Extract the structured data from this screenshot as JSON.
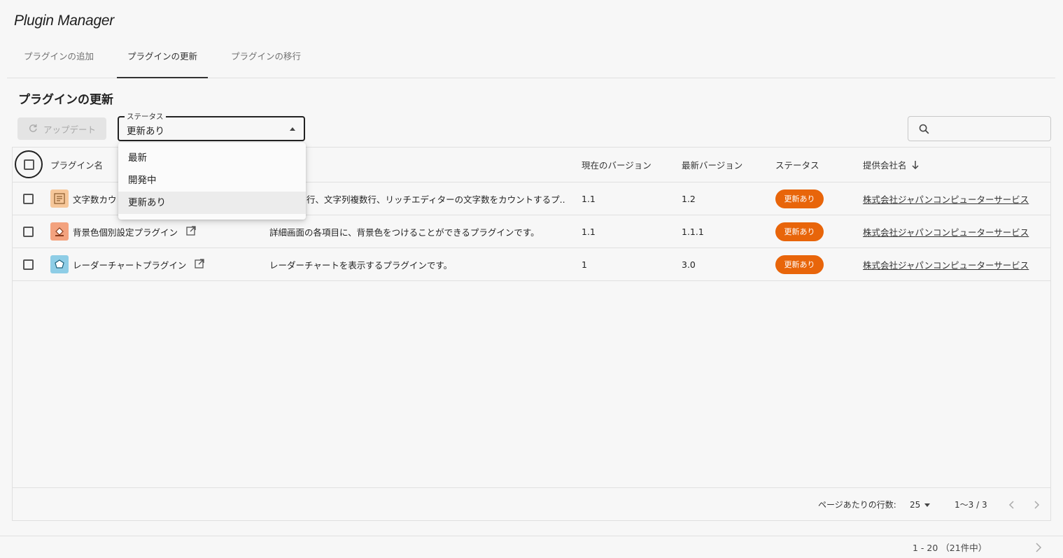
{
  "app": {
    "title": "Plugin Manager"
  },
  "tabs": [
    {
      "label": "プラグインの追加"
    },
    {
      "label": "プラグインの更新"
    },
    {
      "label": "プラグインの移行"
    }
  ],
  "section": {
    "title": "プラグインの更新"
  },
  "toolbar": {
    "update_label": "アップデート",
    "status_legend": "ステータス",
    "status_value": "更新あり",
    "search_placeholder": ""
  },
  "dropdown": {
    "options": [
      {
        "label": "最新"
      },
      {
        "label": "開発中"
      },
      {
        "label": "更新あり"
      }
    ]
  },
  "table": {
    "headers": {
      "name": "プラグイン名",
      "current_version": "現在のバージョン",
      "latest_version": "最新バージョン",
      "status": "ステータス",
      "company": "提供会社名"
    },
    "rows": [
      {
        "name": "文字数カウ",
        "description": "行、文字列複数行、リッチエディターの文字数をカウントするプ...",
        "current_version": "1.1",
        "latest_version": "1.2",
        "status": "更新あり",
        "company": "株式会社ジャパンコンピューターサービス",
        "icon_color": "#f6c79a"
      },
      {
        "name": "背景色個別設定プラグイン",
        "description": "詳細画面の各項目に、背景色をつけることができるプラグインです。",
        "current_version": "1.1",
        "latest_version": "1.1.1",
        "status": "更新あり",
        "company": "株式会社ジャパンコンピューターサービス",
        "icon_color": "#f3a27e"
      },
      {
        "name": "レーダーチャートプラグイン",
        "description": "レーダーチャートを表示するプラグインです。",
        "current_version": "1",
        "latest_version": "3.0",
        "status": "更新あり",
        "company": "株式会社ジャパンコンピューターサービス",
        "icon_color": "#8ecde6"
      }
    ],
    "footer": {
      "rows_per_page_label": "ページあたりの行数:",
      "rows_per_page_value": "25",
      "range": "1〜3 / 3"
    }
  },
  "bottom": {
    "paging": "1 - 20 （21件中）"
  },
  "colors": {
    "badge": "#e8650a",
    "accent": "#222222"
  }
}
